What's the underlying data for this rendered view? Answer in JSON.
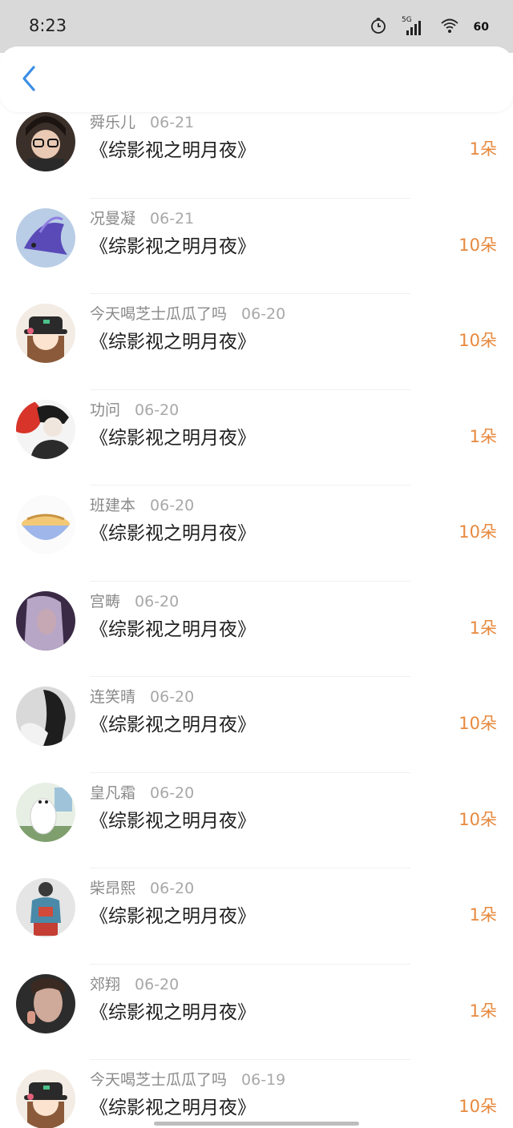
{
  "status_bar": {
    "time": "8:23",
    "battery": "60"
  },
  "list": [
    {
      "name": "舜乐儿",
      "date": "06-21",
      "book": "《综影视之明月夜》",
      "gift": "1朵",
      "avatar": "glasses-girl-avatar"
    },
    {
      "name": "况曼凝",
      "date": "06-21",
      "book": "《综影视之明月夜》",
      "gift": "10朵",
      "avatar": "betta-fish-avatar"
    },
    {
      "name": "今天喝芝士瓜瓜了吗",
      "date": "06-20",
      "book": "《综影视之明月夜》",
      "gift": "10朵",
      "avatar": "cartoon-girl-hat-avatar"
    },
    {
      "name": "功问",
      "date": "06-20",
      "book": "《综影视之明月夜》",
      "gift": "1朵",
      "avatar": "anime-boy-avatar"
    },
    {
      "name": "班建本",
      "date": "06-20",
      "book": "《综影视之明月夜》",
      "gift": "10朵",
      "avatar": "food-bowl-avatar"
    },
    {
      "name": "宫畴",
      "date": "06-20",
      "book": "《综影视之明月夜》",
      "gift": "1朵",
      "avatar": "purple-portrait-avatar"
    },
    {
      "name": "连笑晴",
      "date": "06-20",
      "book": "《综影视之明月夜》",
      "gift": "10朵",
      "avatar": "dark-hair-girl-avatar"
    },
    {
      "name": "皇凡霜",
      "date": "06-20",
      "book": "《综影视之明月夜》",
      "gift": "10朵",
      "avatar": "polar-bear-avatar"
    },
    {
      "name": "柴昂熙",
      "date": "06-20",
      "book": "《综影视之明月夜》",
      "gift": "1朵",
      "avatar": "jacket-figure-avatar"
    },
    {
      "name": "郊翔",
      "date": "06-20",
      "book": "《综影视之明月夜》",
      "gift": "1朵",
      "avatar": "smoking-portrait-avatar"
    },
    {
      "name": "今天喝芝士瓜瓜了吗",
      "date": "06-19",
      "book": "《综影视之明月夜》",
      "gift": "10朵",
      "avatar": "cartoon-girl-hat-avatar"
    }
  ],
  "colors": {
    "accent_blue": "#3a8ee6",
    "gift_orange": "#e7893e",
    "status_bar_bg": "#d9d9d9"
  }
}
